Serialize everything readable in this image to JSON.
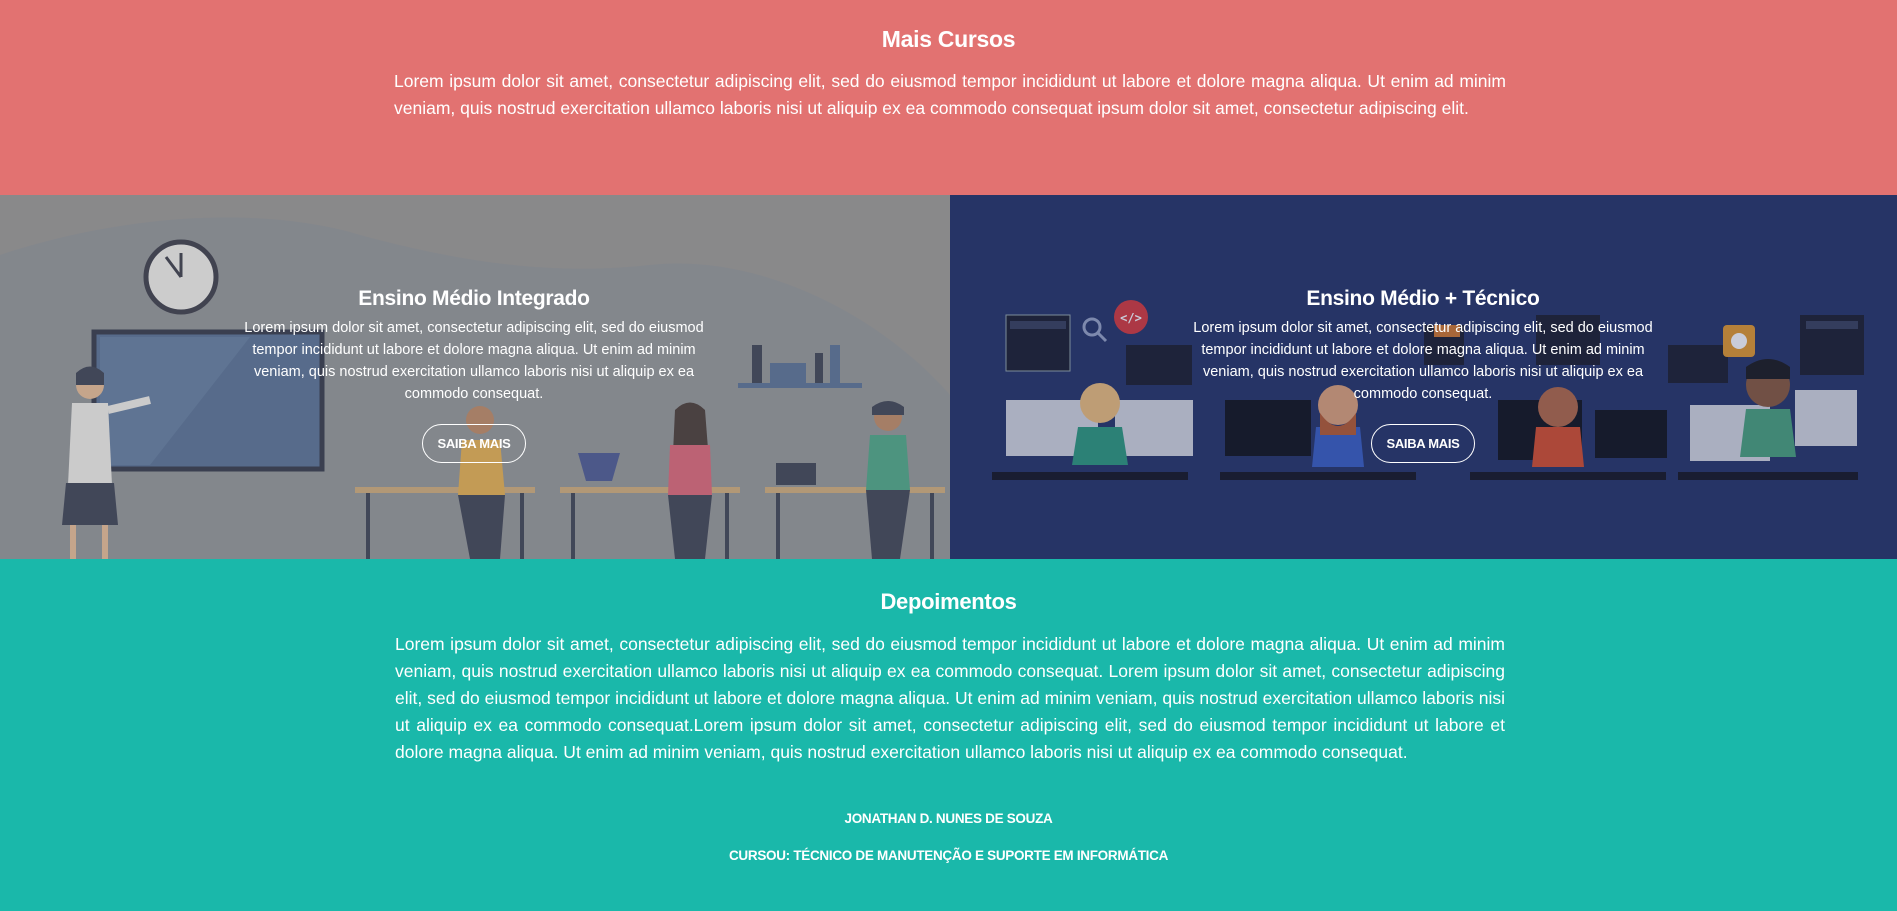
{
  "more_courses": {
    "title": "Mais Cursos",
    "text": "Lorem ipsum dolor sit amet, consectetur adipiscing elit, sed do eiusmod tempor incididunt ut labore et dolore magna aliqua. Ut enim ad minim veniam, quis nostrud exercitation ullamco laboris nisi ut aliquip ex ea commodo consequat ipsum dolor sit amet, consectetur adipiscing elit."
  },
  "courses": [
    {
      "title": "Ensino Médio Integrado",
      "text": "Lorem ipsum dolor sit amet, consectetur adipiscing elit, sed do eiusmod tempor incididunt ut labore et dolore magna aliqua. Ut enim ad minim veniam, quis nostrud exercitation ullamco laboris nisi ut aliquip ex ea commodo consequat.",
      "button": "SAIBA MAIS"
    },
    {
      "title": "Ensino Médio + Técnico",
      "text": "Lorem ipsum dolor sit amet, consectetur adipiscing elit, sed do eiusmod tempor incididunt ut labore et dolore magna aliqua. Ut enim ad minim veniam, quis nostrud exercitation ullamco laboris nisi ut aliquip ex ea commodo consequat.",
      "button": "SAIBA MAIS"
    }
  ],
  "testimonials": {
    "title": "Depoimentos",
    "text": "Lorem ipsum dolor sit amet, consectetur adipiscing elit, sed do eiusmod tempor incididunt ut labore et dolore magna aliqua. Ut enim ad minim veniam, quis nostrud exercitation ullamco laboris nisi ut aliquip ex ea commodo consequat. Lorem ipsum dolor sit amet, consectetur adipiscing elit, sed do eiusmod tempor incididunt ut labore et dolore magna aliqua. Ut enim ad minim veniam, quis nostrud exercitation ullamco laboris nisi ut aliquip ex ea commodo consequat.Lorem ipsum dolor sit amet, consectetur adipiscing elit, sed do eiusmod tempor incididunt ut labore et dolore magna aliqua. Ut enim ad minim veniam, quis nostrud exercitation ullamco laboris nisi ut aliquip ex ea commodo consequat.",
    "author": "JONATHAN D. NUNES DE SOUZA",
    "course": "CURSOU: TÉCNICO DE MANUTENÇÃO E SUPORTE EM INFORMÁTICA"
  },
  "colors": {
    "more_courses_bg": "#e27271",
    "panel_left_bg": "#8a8a8d",
    "panel_right_bg": "#263566",
    "testimonials_bg": "#1ab8aa"
  }
}
